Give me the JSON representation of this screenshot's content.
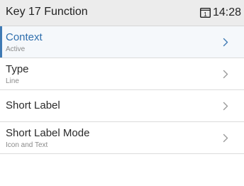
{
  "header": {
    "title": "Key 17 Function",
    "line_icon": "line-1-icon",
    "line_number": "1",
    "time": "14:28"
  },
  "menu": {
    "items": [
      {
        "label": "Context",
        "value": "Active",
        "selected": true,
        "icon": "chevron-right-icon"
      },
      {
        "label": "Type",
        "value": "Line",
        "selected": false,
        "icon": "chevron-right-icon"
      },
      {
        "label": "Short Label",
        "value": "",
        "selected": false,
        "icon": "chevron-right-icon"
      },
      {
        "label": "Short Label Mode",
        "value": "Icon and Text",
        "selected": false,
        "icon": "chevron-right-icon"
      }
    ]
  },
  "colors": {
    "header_bg": "#ececec",
    "selected_accent": "#3f7ab4",
    "selected_text": "#2f6fad",
    "secondary_text": "#8a8a8a",
    "chevron": "#9a9a9a"
  }
}
